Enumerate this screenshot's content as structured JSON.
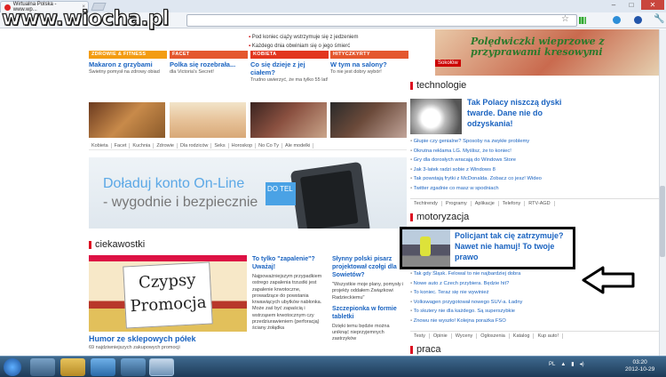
{
  "browser": {
    "tab_title": "Wirtualna Polska - www.wp...",
    "tab_close": "×",
    "window_controls": {
      "minimize": "–",
      "maximize": "□",
      "close": "✕"
    },
    "star": "☆",
    "wrench": "🔧"
  },
  "watermark": "www.wiocha.pl",
  "hero_bullets": [
    "Pod koniec ciąży wstrzymuje się z jedzeniem",
    "Każdego dnia obwiniam się o jego śmierć"
  ],
  "columns": [
    {
      "category": "ZDROWIE & FITNESS",
      "color": "#f39c12",
      "headline": "Makaron z grzybami",
      "desc": "Świetny pomysł na zdrowy obiad"
    },
    {
      "category": "FACET",
      "color": "#e4572e",
      "headline": "Polka się rozebrała...",
      "desc": "dla Victoria's Secret!"
    },
    {
      "category": "KOBIETA",
      "color": "#e2361f",
      "headline": "Co się dzieje z jej ciałem?",
      "desc": "Trudno uwierzyć, że ma tylko 55 lat!"
    },
    {
      "category": "HITYCZKYRTY",
      "color": "#e4572e",
      "headline": "W tym na salony?",
      "desc": "To nie jest dobry wybór!"
    }
  ],
  "tagbar": [
    "Kobieta",
    "Facet",
    "Kuchnia",
    "Zdrowie",
    "Dla rodziców",
    "Seks",
    "Horoskop",
    "No Co Ty",
    "Ale modelki"
  ],
  "banner": {
    "line1": "Doładuj konto On-Line",
    "line2": "- wygodnie i bezpiecznie",
    "tag": "DO TEL"
  },
  "ciekawostki": {
    "heading": "ciekawostki",
    "sign_line1": "Czypsy",
    "sign_line2": "Promocja",
    "title": "Humor ze sklepowych półek",
    "sub": "69 najdziwniejszych zakupowych promocji",
    "col2_head": "To tylko \"zapalenie\"? Uważaj!",
    "col2_text": "Najpoważniejszym przypadkiem ostrego zapalenia trzustki jest zapalenie krwotoczne, prowadzące do powstania krwawiących ubytków nabłonka. Może zaś być zapaścią i wstrząsem krwotocznym czy przedziurawieniem (perforacją) ściany żołądka",
    "col3_head": "Słynny polski pisarz projektował czołgi dla Sowietów?",
    "col3_text": "\"Wszystkie moje plany, pomysły i projekty oddałem Związkowi Radzieckiemu\"",
    "col3_head2": "Szczepionka w formie tabletki",
    "col3_text2": "Dzięki temu będzie można uniknąć nieprzyjemnych zastrzyków"
  },
  "right": {
    "food_label": "Polędwiczki wieprzowe z przyprawami kresowymi",
    "food_brand": "Sokołów",
    "technologie": "technologie",
    "tech_headline": "Tak Polacy niszczą dyski twarde. Dane nie do odzyskania!",
    "tech_list": [
      "Głupie czy genialne? Sposoby na zwykłe problemy",
      "Okrutna reklama LG. Myślisz, że to koniec!",
      "Gry dla dorosłych wracają do Windows Store",
      "Jak 3-latek radzi sobie z Windows 8",
      "Tak powstają frytki z McDonalda. Zobacz co jesz! Wideo",
      "Twitter zgadnie co masz w spodniach"
    ],
    "tech_tabs": [
      "Techtrendy",
      "Programy",
      "Aplikacje",
      "Telefony",
      "RTV-AGD"
    ],
    "motoryzacja": "motoryzacja",
    "moto_headline": "Policjant tak cię zatrzymuje? Nawet nie hamuj! To twoje prawo",
    "moto_list": [
      "Tak gdy Śląsk. Felowal to nie najbardziej dobra",
      "Nowe auto z Czech przybiera. Będzie hit?",
      "To koniec. Teraz się nie wywinież",
      "Volkswagen przygotował nowego SUV-a. Ładny",
      "To skutery nie dla każdego. Są superszybkie",
      "Znowu nie wyszło! Kolejna porażka FSO"
    ],
    "moto_tabs": [
      "Testy",
      "Opinie",
      "Wyceny",
      "Ogłoszenia",
      "Katalog",
      "Kup auto!"
    ],
    "praca": "praca"
  },
  "taskbar": {
    "lang": "PL",
    "time": "03:20",
    "date": "2012-10-29"
  }
}
